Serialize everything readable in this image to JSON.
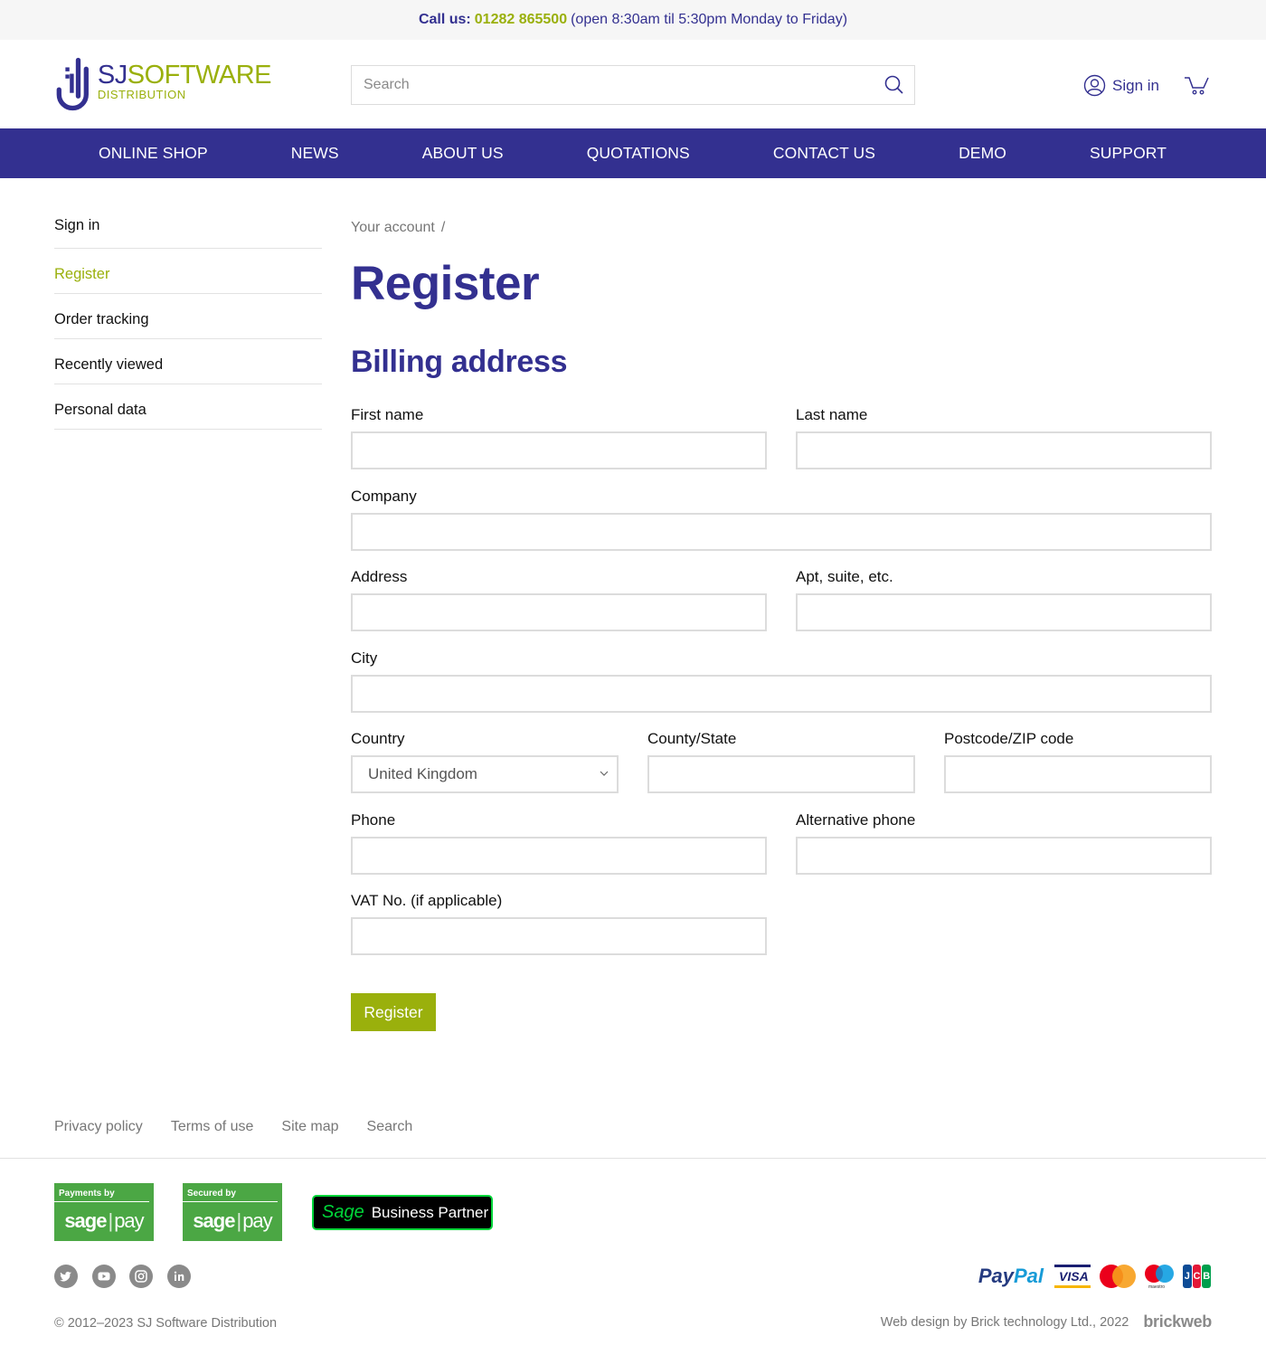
{
  "topbar": {
    "call_label": "Call us:",
    "phone": "01282 865500",
    "hours": "(open 8:30am til 5:30pm Monday to Friday)"
  },
  "header": {
    "logo_sj": "SJ",
    "logo_software": "SOFTWARE",
    "logo_distribution": "DISTRIBUTION",
    "search_placeholder": "Search",
    "search_value": "",
    "signin_label": "Sign in"
  },
  "nav": {
    "items": [
      "ONLINE SHOP",
      "NEWS",
      "ABOUT US",
      "QUOTATIONS",
      "CONTACT US",
      "DEMO",
      "SUPPORT"
    ]
  },
  "sidebar": {
    "items": [
      {
        "label": "Sign in",
        "active": false
      },
      {
        "label": "Register",
        "active": true
      },
      {
        "label": "Order tracking",
        "active": false
      },
      {
        "label": "Recently viewed",
        "active": false
      },
      {
        "label": "Personal data",
        "active": false
      }
    ]
  },
  "main": {
    "breadcrumb": {
      "parent": "Your account",
      "separator": "/"
    },
    "title": "Register",
    "section_title": "Billing address",
    "fields": {
      "first_name": {
        "label": "First name",
        "value": ""
      },
      "last_name": {
        "label": "Last name",
        "value": ""
      },
      "company": {
        "label": "Company",
        "value": ""
      },
      "address": {
        "label": "Address",
        "value": ""
      },
      "apt": {
        "label": "Apt, suite, etc.",
        "value": ""
      },
      "city": {
        "label": "City",
        "value": ""
      },
      "country": {
        "label": "Country",
        "value": "United Kingdom"
      },
      "county": {
        "label": "County/State",
        "value": ""
      },
      "postcode": {
        "label": "Postcode/ZIP code",
        "value": ""
      },
      "phone": {
        "label": "Phone",
        "value": ""
      },
      "alt_phone": {
        "label": "Alternative phone",
        "value": ""
      },
      "vat": {
        "label": "VAT No. (if applicable)",
        "value": ""
      }
    },
    "submit_label": "Register"
  },
  "footer": {
    "links": [
      "Privacy policy",
      "Terms of use",
      "Site map",
      "Search"
    ],
    "badges": {
      "payments_by": "Payments by",
      "secured_by": "Secured by",
      "sage": "sage",
      "pay": "pay",
      "partner_sage": "Sage",
      "partner_text": "Business Partner"
    },
    "social": [
      "twitter",
      "youtube",
      "instagram",
      "linkedin"
    ],
    "payment_methods": {
      "paypal_1": "Pay",
      "paypal_2": "Pal",
      "visa": "VISA",
      "maestro": "maestro",
      "jcb": [
        "J",
        "C",
        "B"
      ]
    },
    "copyright": "© 2012–2023 SJ Software Distribution",
    "webdesign": "Web design by Brick technology Ltd., 2022",
    "brickweb": "brickweb"
  },
  "colors": {
    "brand_blue": "#333090",
    "brand_green": "#9ab00c",
    "sage_green": "#4ba744",
    "partner_green": "#00d639"
  }
}
